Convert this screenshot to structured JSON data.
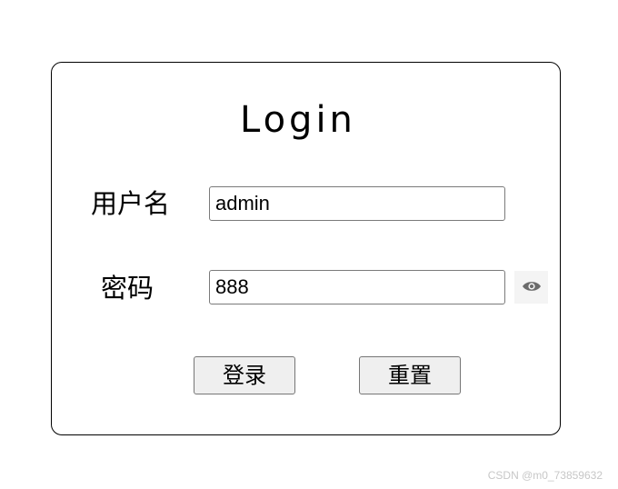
{
  "form": {
    "title": "Login",
    "username_label": "用户名",
    "username_value": "admin",
    "password_label": "密码",
    "password_value": "888",
    "toggle_icon": "eye-icon",
    "login_button": "登录",
    "reset_button": "重置"
  },
  "watermark": "CSDN @m0_73859632",
  "colors": {
    "border": "#000000",
    "input_border": "#7a7a7a",
    "button_bg": "#efefef",
    "icon": "#6b6b6b",
    "watermark": "#c7c7c7"
  }
}
